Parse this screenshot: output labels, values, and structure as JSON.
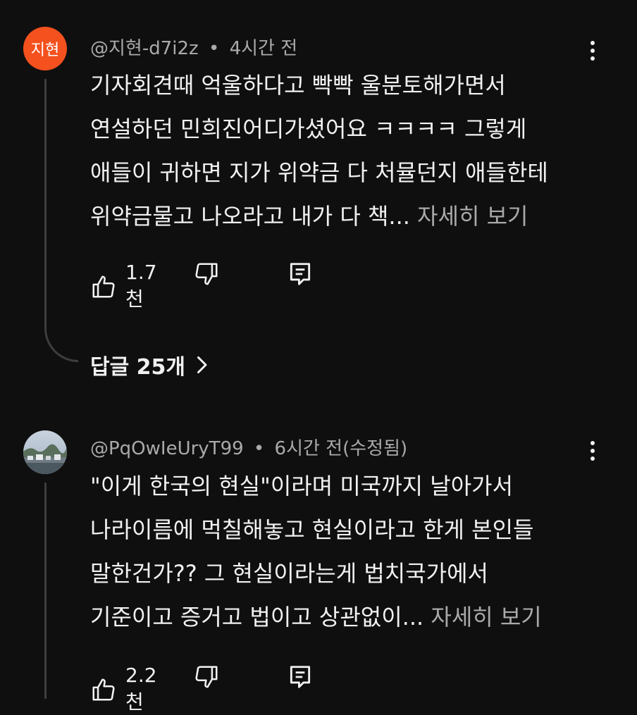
{
  "comments": [
    {
      "avatar_text": "지현",
      "avatar_color": "#f4511e",
      "handle": "@지현-d7i2z",
      "separator": "•",
      "time": "4시간 전",
      "lines": [
        "기자회견때 억울하다고 빡빡 울분토해가면서",
        "연설하던 민희진어디가셨어요 ㅋㅋㅋㅋ 그렇게",
        "애들이 귀하면 지가 위약금 다 처뮬던지 애들한테",
        "위약금물고 나오라고 내가 다 책..."
      ],
      "read_more": "자세히 보기",
      "likes": "1.7천",
      "replies_label": "답글 25개"
    },
    {
      "avatar_text": "",
      "handle": "@PqOwIeUryT99",
      "separator": "•",
      "time": "6시간 전(수정됨)",
      "lines": [
        "\"이게 한국의 현실\"이라며 미국까지 날아가서",
        "나라이름에 먹칠해놓고 현실이라고 한게 본인들",
        "말한건가?? 그 현실이라는게 법치국가에서",
        "기준이고 증거고 법이고 상관없이..."
      ],
      "read_more": "자세히 보기",
      "likes": "2.2천"
    }
  ],
  "icons": {
    "like": "thumbs-up-icon",
    "dislike": "thumbs-down-icon",
    "reply": "comment-icon",
    "menu": "more-vertical-icon",
    "chevron": "chevron-right-icon"
  },
  "colors": {
    "background": "#0f0f0f",
    "text": "#f1f1f1",
    "secondary": "#aaaaaa"
  }
}
